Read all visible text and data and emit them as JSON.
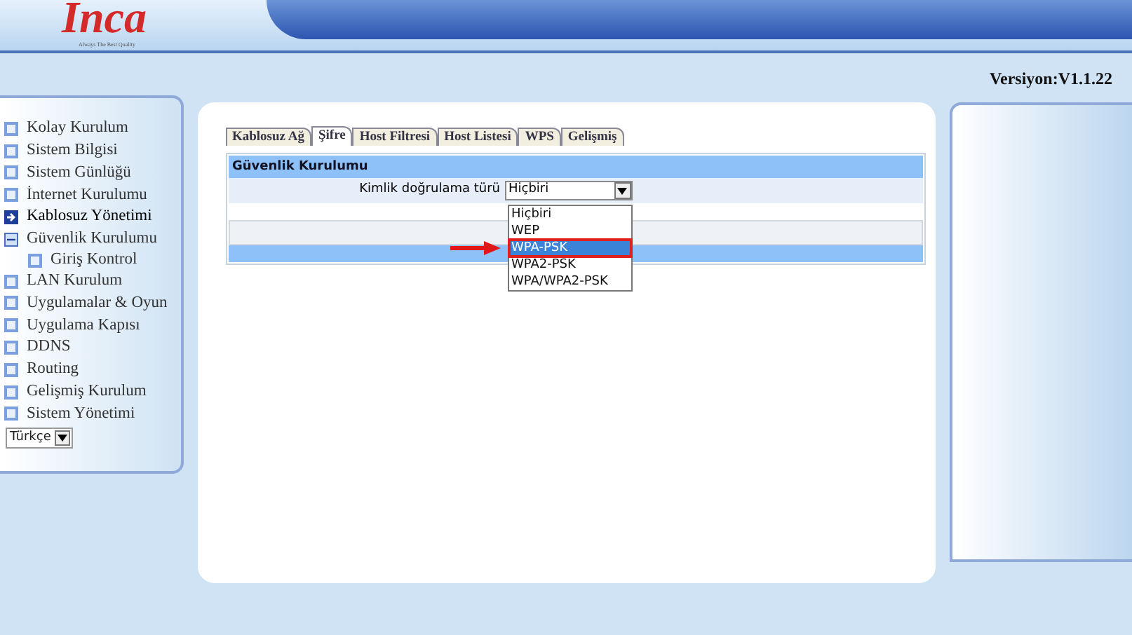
{
  "header": {
    "logo": "Inca",
    "tagline": "Always The Best Quality",
    "version": "Versiyon:V1.1.22"
  },
  "sidebar": {
    "items": [
      {
        "label": "Kolay Kurulum",
        "selected": false,
        "expanded": false
      },
      {
        "label": "Sistem Bilgisi",
        "selected": false,
        "expanded": false
      },
      {
        "label": "Sistem Günlüğü",
        "selected": false,
        "expanded": false
      },
      {
        "label": "İnternet Kurulumu",
        "selected": false,
        "expanded": false
      },
      {
        "label": "Kablosuz Yönetimi",
        "selected": true,
        "expanded": false
      },
      {
        "label": "Güvenlik Kurulumu",
        "selected": false,
        "expanded": true,
        "children": [
          {
            "label": "Giriş Kontrol",
            "selected": false
          }
        ]
      },
      {
        "label": "LAN Kurulum",
        "selected": false,
        "expanded": false
      },
      {
        "label": "Uygulamalar & Oyun",
        "selected": false,
        "expanded": false
      },
      {
        "label": "Uygulama Kapısı",
        "selected": false,
        "expanded": false
      },
      {
        "label": "DDNS",
        "selected": false,
        "expanded": false
      },
      {
        "label": "Routing",
        "selected": false,
        "expanded": false
      },
      {
        "label": "Gelişmiş Kurulum",
        "selected": false,
        "expanded": false
      },
      {
        "label": "Sistem Yönetimi",
        "selected": false,
        "expanded": false
      }
    ],
    "language": "Türkçe"
  },
  "tabs": [
    {
      "label": "Kablosuz Ağ",
      "selected": false
    },
    {
      "label": "Şifre",
      "selected": true
    },
    {
      "label": "Host Filtresi",
      "selected": false
    },
    {
      "label": "Host Listesi",
      "selected": false
    },
    {
      "label": "WPS",
      "selected": false
    },
    {
      "label": "Gelişmiş",
      "selected": false
    }
  ],
  "section": {
    "title": "Güvenlik Kurulumu",
    "field_label": "Kimlik doğrulama türü",
    "value": "Hiçbiri",
    "options": [
      {
        "label": "Hiçbiri",
        "highlighted": false,
        "outlined": false
      },
      {
        "label": "WEP",
        "highlighted": false,
        "outlined": false
      },
      {
        "label": "WPA-PSK",
        "highlighted": true,
        "outlined": true
      },
      {
        "label": "WPA2-PSK",
        "highlighted": false,
        "outlined": false
      },
      {
        "label": "WPA/WPA2-PSK",
        "highlighted": false,
        "outlined": false
      }
    ]
  }
}
